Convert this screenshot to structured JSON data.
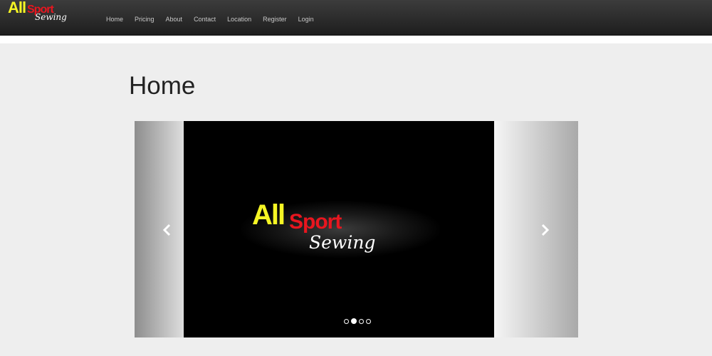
{
  "brand": {
    "word1": "All",
    "word2": "Sport",
    "word3": "Sewing"
  },
  "nav": {
    "items": [
      "Home",
      "Pricing",
      "About",
      "Contact",
      "Location",
      "Register",
      "Login"
    ]
  },
  "page": {
    "title": "Home"
  },
  "carousel": {
    "slide_logo": {
      "word1": "All",
      "word2": "Sport",
      "word3": "Sewing"
    },
    "indicator_count": 4,
    "active_index": 1,
    "prev_icon": "chevron-left-icon",
    "next_icon": "chevron-right-icon"
  },
  "colors": {
    "navbar": "#2b2b2b",
    "background": "#eeeeee",
    "logo_yellow": "#f5f524",
    "logo_red": "#e8161f"
  }
}
